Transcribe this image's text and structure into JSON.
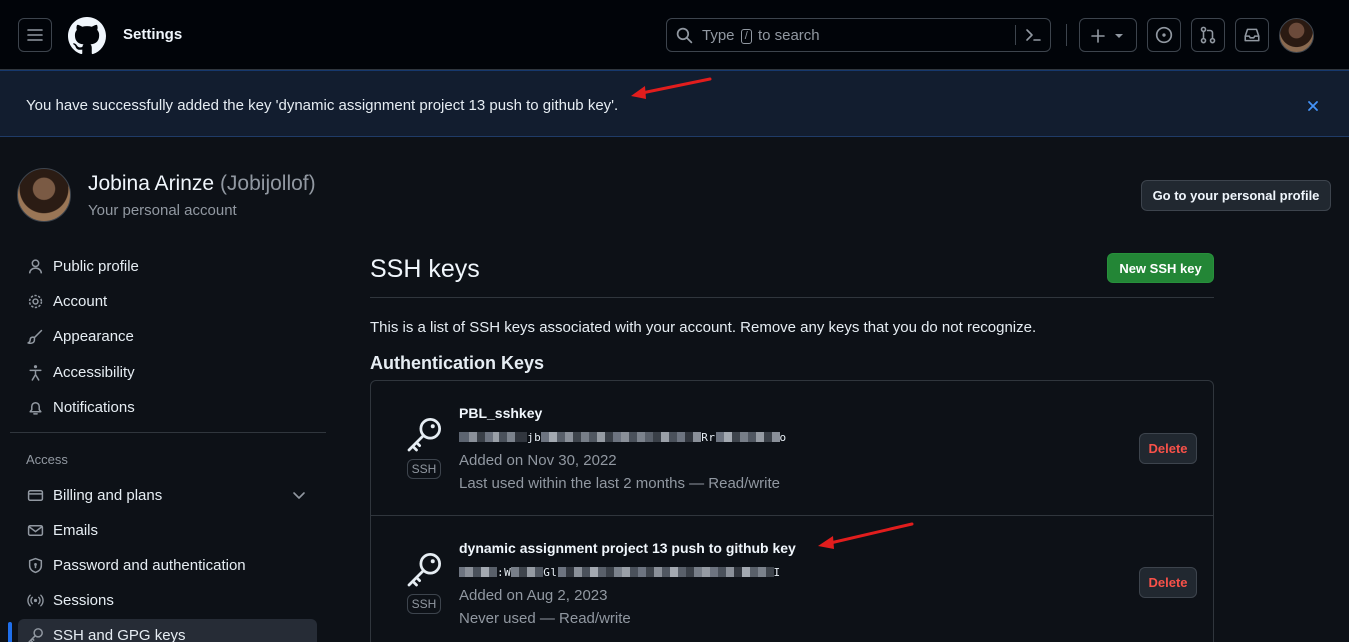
{
  "header": {
    "context_title": "Settings",
    "search_prefix": "Type",
    "search_key": "/",
    "search_suffix": "to search"
  },
  "flash": {
    "message": "You have successfully added the key 'dynamic assignment project 13 push to github key'."
  },
  "profile": {
    "name": "Jobina Arinze",
    "login": "(Jobijollof)",
    "subtitle": "Your personal account",
    "profile_button": "Go to your personal profile"
  },
  "sidebar": {
    "items": [
      {
        "label": "Public profile",
        "icon": "person-icon"
      },
      {
        "label": "Account",
        "icon": "gear-icon"
      },
      {
        "label": "Appearance",
        "icon": "paintbrush-icon"
      },
      {
        "label": "Accessibility",
        "icon": "accessibility-icon"
      },
      {
        "label": "Notifications",
        "icon": "bell-icon"
      }
    ],
    "access_heading": "Access",
    "access_items": [
      {
        "label": "Billing and plans",
        "icon": "credit-card-icon"
      },
      {
        "label": "Emails",
        "icon": "mail-icon"
      },
      {
        "label": "Password and authentication",
        "icon": "shield-lock-icon"
      },
      {
        "label": "Sessions",
        "icon": "broadcast-icon"
      },
      {
        "label": "SSH and GPG keys",
        "icon": "key-icon"
      }
    ]
  },
  "main": {
    "title": "SSH keys",
    "new_button": "New SSH key",
    "intro": "This is a list of SSH keys associated with your account. Remove any keys that you do not recognize.",
    "auth_heading": "Authentication Keys",
    "keys": [
      {
        "title": "PBL_sshkey",
        "badge": "SSH",
        "fingerprint_a": "jb",
        "fingerprint_b": "Rr",
        "fingerprint_c": "o",
        "added": "Added on Nov 30, 2022",
        "last_used": "Last used within the last 2 months — Read/write",
        "delete_label": "Delete"
      },
      {
        "title": "dynamic assignment project 13 push to github key",
        "badge": "SSH",
        "fingerprint_a": ":W",
        "fingerprint_b": "Gl",
        "fingerprint_c": "I",
        "added": "Added on Aug 2, 2023",
        "last_used": "Never used — Read/write",
        "delete_label": "Delete"
      }
    ]
  },
  "colors": {
    "accent_green": "#238636",
    "danger": "#f85149",
    "link_blue": "#1f6feb",
    "annotation_red": "#e11d1d"
  }
}
